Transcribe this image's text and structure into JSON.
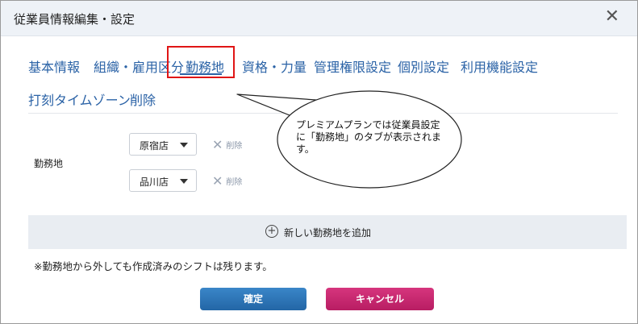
{
  "dialog": {
    "title": "従業員情報編集・設定",
    "close_symbol": "✕"
  },
  "tabs_row1": [
    {
      "label": "基本情報"
    },
    {
      "label": "組織・雇用区分"
    },
    {
      "label": "勤務地"
    },
    {
      "label": "資格・力量"
    },
    {
      "label": "管理権限設定"
    },
    {
      "label": "個別設定"
    },
    {
      "label": "利用機能設定"
    }
  ],
  "tabs_row2": [
    {
      "label": "打刻タイムゾーン"
    },
    {
      "label": "削除"
    }
  ],
  "active_tab": "勤務地",
  "workplace": {
    "label": "勤務地",
    "entries": [
      {
        "value": "原宿店",
        "remove_label": "削除"
      },
      {
        "value": "品川店",
        "remove_label": "削除"
      }
    ],
    "add_label": "新しい勤務地を追加"
  },
  "note": "※勤務地から外しても作成済みのシフトは残ります。",
  "buttons": {
    "confirm": "確定",
    "cancel": "キャンセル"
  },
  "callout": {
    "text": "プレミアムプランでは従業員設定に「勤務地」のタブが表示されます。"
  },
  "colors": {
    "accent": "#2a62a6",
    "highlight": "#e01515",
    "confirm": "#2a72b5",
    "cancel": "#c52870"
  }
}
